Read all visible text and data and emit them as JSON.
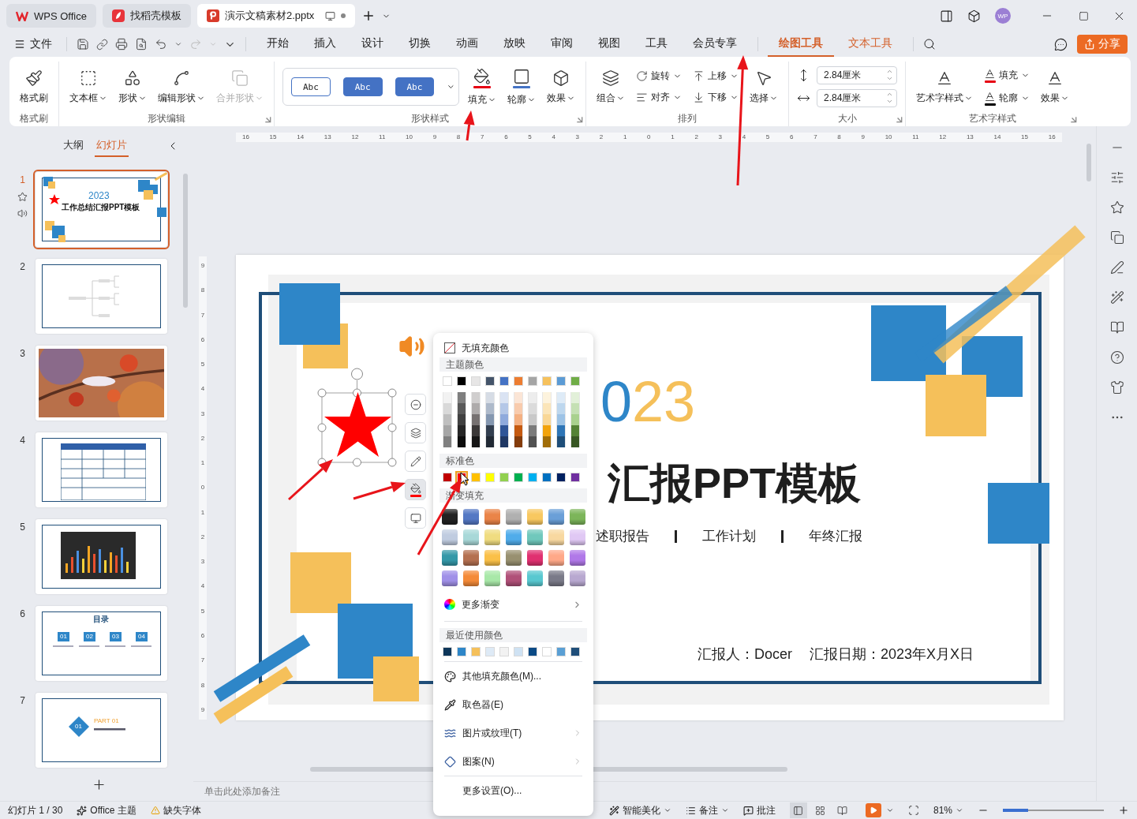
{
  "title_bar": {
    "tabs": [
      {
        "label": "WPS Office",
        "kind": "wps",
        "selected": false
      },
      {
        "label": "找稻壳模板",
        "kind": "docer",
        "selected": false
      },
      {
        "label": "演示文稿素材2.pptx",
        "kind": "ppt",
        "selected": true
      }
    ],
    "avatar": "WP"
  },
  "menu_bar": {
    "file": "文件",
    "tabs": [
      {
        "label": "开始",
        "selected": false,
        "contextual": false
      },
      {
        "label": "插入",
        "selected": false,
        "contextual": false
      },
      {
        "label": "设计",
        "selected": false,
        "contextual": false
      },
      {
        "label": "切换",
        "selected": false,
        "contextual": false
      },
      {
        "label": "动画",
        "selected": false,
        "contextual": false
      },
      {
        "label": "放映",
        "selected": false,
        "contextual": false
      },
      {
        "label": "审阅",
        "selected": false,
        "contextual": false
      },
      {
        "label": "视图",
        "selected": false,
        "contextual": false
      },
      {
        "label": "工具",
        "selected": false,
        "contextual": false
      },
      {
        "label": "会员专享",
        "selected": false,
        "contextual": false
      },
      {
        "label": "绘图工具",
        "selected": true,
        "contextual": true
      },
      {
        "label": "文本工具",
        "selected": false,
        "contextual": true
      }
    ],
    "share": "分享"
  },
  "ribbon": [
    {
      "label": "格式刷",
      "columns": [
        [
          {
            "label": "格式刷",
            "caret": false,
            "disabled": false
          }
        ]
      ]
    },
    {
      "label": "形状编辑",
      "launcher": true,
      "columns": [
        [
          {
            "label": "文本框",
            "caret": true,
            "disabled": false
          }
        ],
        [
          {
            "label": "形状",
            "caret": true,
            "disabled": false
          }
        ],
        [
          {
            "label": "编辑形状",
            "caret": true,
            "disabled": false
          }
        ],
        [
          {
            "label": "合并形状",
            "caret": true,
            "disabled": true
          }
        ]
      ]
    },
    {
      "label": "形状样式",
      "launcher": true,
      "gallery": [
        {
          "label": "Abc",
          "kind": "outline"
        },
        {
          "label": "Abc",
          "kind": "filled"
        },
        {
          "label": "Abc",
          "kind": "filled"
        }
      ],
      "columns": [
        [
          {
            "label": "填充",
            "caret": true,
            "disabled": false,
            "color": "#e60012"
          }
        ],
        [
          {
            "label": "轮廓",
            "caret": true,
            "disabled": false,
            "color": "#4472c4"
          }
        ],
        [
          {
            "label": "效果",
            "caret": true,
            "disabled": false
          }
        ]
      ]
    },
    {
      "label": "排列",
      "columns": [
        [
          {
            "label": "组合",
            "caret": true,
            "disabled": false
          }
        ],
        [
          {
            "label": "旋转",
            "caret": true,
            "disabled": false
          },
          {
            "label": "对齐",
            "caret": true,
            "disabled": false
          }
        ],
        [
          {
            "label": "上移",
            "caret": true,
            "disabled": false
          },
          {
            "label": "下移",
            "caret": true,
            "disabled": false
          }
        ],
        [
          {
            "label": "选择",
            "caret": true,
            "disabled": false
          }
        ]
      ]
    },
    {
      "label": "大小",
      "launcher": true,
      "spins": [
        {
          "value": "2.84厘米"
        },
        {
          "value": "2.84厘米"
        }
      ]
    },
    {
      "label": "艺术字样式",
      "launcher": true,
      "columns": [
        [
          {
            "label": "艺术字样式",
            "caret": true,
            "disabled": false
          }
        ],
        [
          {
            "label": "填充",
            "caret": true,
            "disabled": false,
            "color": "#e60012"
          },
          {
            "label": "轮廓",
            "caret": true,
            "disabled": false,
            "color": "#000000"
          }
        ],
        [
          {
            "label": "效果",
            "caret": true,
            "disabled": false
          }
        ]
      ]
    }
  ],
  "panel_tabs": [
    {
      "label": "大纲",
      "selected": false
    },
    {
      "label": "幻灯片",
      "selected": true
    }
  ],
  "slides": [
    {
      "number": "1",
      "selected": true,
      "animation": true,
      "audio": true,
      "kind": "title",
      "texts": [
        "2023",
        "工作总结汇报PPT模板"
      ]
    },
    {
      "number": "2",
      "selected": false,
      "kind": "mindmap"
    },
    {
      "number": "3",
      "selected": false
    },
    {
      "number": "4",
      "selected": false,
      "kind": "table"
    },
    {
      "number": "5",
      "selected": false,
      "kind": "chart"
    },
    {
      "number": "6",
      "selected": false,
      "kind": "toc",
      "texts": [
        "目录",
        "01",
        "02",
        "03",
        "04"
      ]
    },
    {
      "number": "7",
      "selected": false,
      "kind": "part",
      "texts": [
        "01",
        "PART 01"
      ]
    }
  ],
  "rulers": {
    "horizontal": [
      "16",
      "15",
      "14",
      "13",
      "12",
      "11",
      "10",
      "9",
      "8",
      "7",
      "6",
      "5",
      "4",
      "3",
      "2",
      "1",
      "0",
      "1",
      "2",
      "3",
      "4",
      "5",
      "6",
      "7",
      "8",
      "9",
      "10",
      "11",
      "12",
      "13",
      "14",
      "15",
      "16"
    ],
    "vertical": [
      "9",
      "8",
      "7",
      "6",
      "5",
      "4",
      "3",
      "2",
      "1",
      "0",
      "1",
      "2",
      "3",
      "4",
      "5",
      "6",
      "7",
      "8",
      "9"
    ]
  },
  "slide": {
    "year": [
      {
        "text": "0",
        "color": "#2e86c8"
      },
      {
        "text": "23",
        "color": "#f5c05a"
      }
    ],
    "title": "汇报PPT模板",
    "subtitle_items": [
      "述职报告",
      "工作计划",
      "年终汇报"
    ],
    "reporter": "汇报人：Docer",
    "date": "汇报日期：2023年X月X日",
    "shape": {
      "kind": "star",
      "color": "#ff0000",
      "selected": true
    }
  },
  "float_toolbar": [
    {
      "selected": false
    },
    {
      "selected": false
    },
    {
      "selected": false
    },
    {
      "selected": true
    },
    {
      "selected": false
    }
  ],
  "notes": {
    "placeholder": "单击此处添加备注"
  },
  "fill_menu": {
    "no_fill": "无填充颜色",
    "theme_heading": "主题颜色",
    "theme_colors": [
      {
        "color": "#ffffff"
      },
      {
        "color": "#000000"
      },
      {
        "color": "#e7e6e6"
      },
      {
        "color": "#44546a"
      },
      {
        "color": "#4472c4"
      },
      {
        "color": "#ed7d31"
      },
      {
        "color": "#a5a5a5"
      },
      {
        "color": "#f6c15c"
      },
      {
        "color": "#5b9bd5"
      },
      {
        "color": "#70ad47"
      }
    ],
    "theme_shades": [
      [
        {
          "color": "#f2f2f2"
        },
        {
          "color": "#7f7f7f"
        },
        {
          "color": "#d0cece"
        },
        {
          "color": "#d6dce5"
        },
        {
          "color": "#dae3f3"
        },
        {
          "color": "#fbe5d6"
        },
        {
          "color": "#ededed"
        },
        {
          "color": "#fdf3dd"
        },
        {
          "color": "#deebf7"
        },
        {
          "color": "#e2f0d9"
        }
      ],
      [
        {
          "color": "#d9d9d9"
        },
        {
          "color": "#595959"
        },
        {
          "color": "#aeabab"
        },
        {
          "color": "#adb9ca"
        },
        {
          "color": "#b4c7e7"
        },
        {
          "color": "#f8cbad"
        },
        {
          "color": "#dbdbdb"
        },
        {
          "color": "#fbe5b9"
        },
        {
          "color": "#bdd7ee"
        },
        {
          "color": "#c5e0b4"
        }
      ],
      [
        {
          "color": "#bfbfbf"
        },
        {
          "color": "#404040"
        },
        {
          "color": "#767171"
        },
        {
          "color": "#8497b0"
        },
        {
          "color": "#8faadc"
        },
        {
          "color": "#f4b183"
        },
        {
          "color": "#c9c9c9"
        },
        {
          "color": "#f9d796"
        },
        {
          "color": "#9dc3e6"
        },
        {
          "color": "#a9d18e"
        }
      ],
      [
        {
          "color": "#a6a6a6"
        },
        {
          "color": "#262626"
        },
        {
          "color": "#3b3838"
        },
        {
          "color": "#333f50"
        },
        {
          "color": "#2f5597"
        },
        {
          "color": "#c55a11"
        },
        {
          "color": "#7b7b7b"
        },
        {
          "color": "#f2a30c"
        },
        {
          "color": "#2e75b6"
        },
        {
          "color": "#548235"
        }
      ],
      [
        {
          "color": "#808080"
        },
        {
          "color": "#0d0d0d"
        },
        {
          "color": "#171616"
        },
        {
          "color": "#222a35"
        },
        {
          "color": "#203864"
        },
        {
          "color": "#843c0c"
        },
        {
          "color": "#525252"
        },
        {
          "color": "#a16d08"
        },
        {
          "color": "#1f4e79"
        },
        {
          "color": "#385723"
        }
      ]
    ],
    "standard_heading": "标准色",
    "standard_colors": [
      {
        "color": "#c00000",
        "selected": false
      },
      {
        "color": "#ff0000",
        "selected": true
      },
      {
        "color": "#ffc000",
        "selected": false
      },
      {
        "color": "#ffff00",
        "selected": false
      },
      {
        "color": "#92d050",
        "selected": false
      },
      {
        "color": "#00b050",
        "selected": false
      },
      {
        "color": "#00b0f0",
        "selected": false
      },
      {
        "color": "#0070c0",
        "selected": false
      },
      {
        "color": "#002060",
        "selected": false
      },
      {
        "color": "#7030a0",
        "selected": false
      }
    ],
    "gradient_heading": "渐变填充",
    "gradients": [
      [
        {
          "color": "#222222"
        },
        {
          "color": "#5478c4"
        },
        {
          "color": "#ea8448"
        },
        {
          "color": "#b0b0b0"
        },
        {
          "color": "#f8c860"
        },
        {
          "color": "#6a9fd8"
        },
        {
          "color": "#7cb55a"
        }
      ],
      [
        {
          "color": "#c0cce0"
        },
        {
          "color": "#a8d8d8"
        },
        {
          "color": "#f0dc80"
        },
        {
          "color": "#50acea"
        },
        {
          "color": "#70c8bc"
        },
        {
          "color": "#f8d8a0"
        },
        {
          "color": "#e0c8f4"
        }
      ],
      [
        {
          "color": "#3498a8"
        },
        {
          "color": "#b47050"
        },
        {
          "color": "#fac048"
        },
        {
          "color": "#989070"
        },
        {
          "color": "#e03070"
        },
        {
          "color": "#ffa888"
        },
        {
          "color": "#b078e8"
        }
      ],
      [
        {
          "color": "#a090e8"
        },
        {
          "color": "#f48a38"
        },
        {
          "color": "#a8e8a8"
        },
        {
          "color": "#b05078"
        },
        {
          "color": "#58c8d0"
        },
        {
          "color": "#7a7a88"
        },
        {
          "color": "#b8a8d0"
        }
      ]
    ],
    "more_gradients": "更多渐变",
    "recent_heading": "最近使用颜色",
    "recent_colors": [
      {
        "color": "#0d3659"
      },
      {
        "color": "#2e86c8"
      },
      {
        "color": "#f5c05a"
      },
      {
        "color": "#deeaf6"
      },
      {
        "color": "#f2f2f2"
      },
      {
        "color": "#cfe2f3"
      },
      {
        "color": "#0b4a85"
      },
      {
        "color": "#ffffff"
      },
      {
        "color": "#5a9fd4"
      },
      {
        "color": "#1f4e79"
      }
    ],
    "actions": [
      {
        "label": "其他填充颜色(M)...",
        "kind": "palette",
        "submenu": false
      },
      {
        "label": "取色器(E)",
        "kind": "eyedropper",
        "submenu": false
      },
      {
        "label": "图片或纹理(T)",
        "kind": "texture",
        "submenu": true
      },
      {
        "label": "图案(N)",
        "kind": "pattern",
        "submenu": true
      },
      {
        "label": "更多设置(O)...",
        "kind": "plain",
        "submenu": false
      }
    ]
  },
  "status_bar": {
    "slide_info": "幻灯片 1 / 30",
    "theme": "Office 主题",
    "missing_font": "缺失字体",
    "beautify": "智能美化",
    "notes": "备注",
    "comments": "批注",
    "views": [
      {
        "selected": true
      },
      {
        "selected": false
      },
      {
        "selected": false
      }
    ],
    "zoom": "81%",
    "zoom_slider": {
      "level": 0.25
    }
  },
  "annotations": [
    {
      "kind": "arrow"
    },
    {
      "kind": "arrow"
    },
    {
      "kind": "arrow"
    },
    {
      "kind": "arrow"
    },
    {
      "kind": "arrow"
    }
  ]
}
